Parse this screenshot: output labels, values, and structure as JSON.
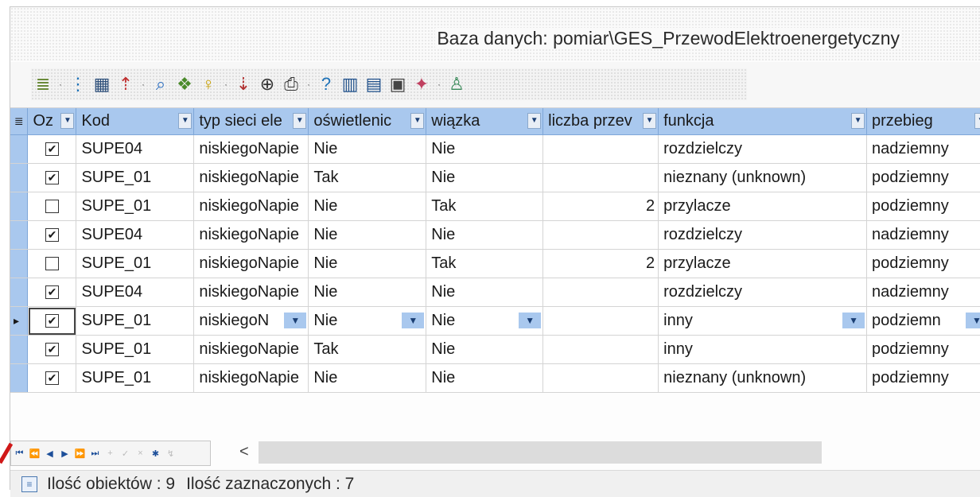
{
  "window": {
    "title": "Baza danych: pomiar\\GES_PrzewodElektroenergetyczny"
  },
  "toolbar": {
    "buttons": [
      {
        "name": "list-view-icon",
        "glyph": "≣",
        "color": "#6a8a3a",
        "dropdown": true
      },
      {
        "name": "tree-view-icon",
        "glyph": "⋮",
        "color": "#1e72b8",
        "dropdown": false
      },
      {
        "name": "table-view-icon",
        "glyph": "▦",
        "color": "#2d4f7a",
        "dropdown": false
      },
      {
        "name": "export-icon",
        "glyph": "⇡",
        "color": "#c03030",
        "dropdown": true
      },
      {
        "name": "search-icon",
        "glyph": "⌕",
        "color": "#2d6fc0",
        "dropdown": false
      },
      {
        "name": "find-icon",
        "glyph": "❖",
        "color": "#4a8a2a",
        "dropdown": false
      },
      {
        "name": "bulb-icon",
        "glyph": "♀",
        "color": "#c8a000",
        "dropdown": true
      },
      {
        "name": "xyh-icon",
        "glyph": "⇣",
        "color": "#b03030",
        "dropdown": false
      },
      {
        "name": "zoom-icon",
        "glyph": "⊕",
        "color": "#333333",
        "dropdown": false
      },
      {
        "name": "print-icon",
        "glyph": "⎙",
        "color": "#333333",
        "dropdown": true
      },
      {
        "name": "help-icon",
        "glyph": "?",
        "color": "#1e72b8",
        "dropdown": false
      },
      {
        "name": "columns-icon",
        "glyph": "▥",
        "color": "#1e4f8a",
        "dropdown": false
      },
      {
        "name": "columns-edit-icon",
        "glyph": "▤",
        "color": "#1e4f8a",
        "dropdown": false
      },
      {
        "name": "copy-grid-icon",
        "glyph": "▣",
        "color": "#444444",
        "dropdown": false
      },
      {
        "name": "gml-icon",
        "glyph": "✦",
        "color": "#c04060",
        "dropdown": true
      },
      {
        "name": "user-icon",
        "glyph": "♙",
        "color": "#3a8a5a",
        "dropdown": false
      }
    ]
  },
  "grid": {
    "columns": [
      {
        "label": "Oz"
      },
      {
        "label": "Kod"
      },
      {
        "label": "typ sieci ele"
      },
      {
        "label": "oświetlenic"
      },
      {
        "label": "wiązka"
      },
      {
        "label": "liczba przev"
      },
      {
        "label": "funkcja"
      },
      {
        "label": "przebieg"
      }
    ],
    "rows": [
      {
        "checked": true,
        "kod": "SUPE04",
        "typ": "niskiegoNapie",
        "osw": "Nie",
        "wiazka": "Nie",
        "liczba": "",
        "funkcja": "rozdzielczy",
        "przebieg": "nadziemny"
      },
      {
        "checked": true,
        "kod": "SUPE_01",
        "typ": "niskiegoNapie",
        "osw": "Tak",
        "wiazka": "Nie",
        "liczba": "",
        "funkcja": "nieznany (unknown)",
        "przebieg": "podziemny"
      },
      {
        "checked": false,
        "kod": "SUPE_01",
        "typ": "niskiegoNapie",
        "osw": "Nie",
        "wiazka": "Tak",
        "liczba": "2",
        "funkcja": "przylacze",
        "przebieg": "podziemny"
      },
      {
        "checked": true,
        "kod": "SUPE04",
        "typ": "niskiegoNapie",
        "osw": "Nie",
        "wiazka": "Nie",
        "liczba": "",
        "funkcja": "rozdzielczy",
        "przebieg": "nadziemny"
      },
      {
        "checked": false,
        "kod": "SUPE_01",
        "typ": "niskiegoNapie",
        "osw": "Nie",
        "wiazka": "Tak",
        "liczba": "2",
        "funkcja": "przylacze",
        "przebieg": "podziemny"
      },
      {
        "checked": true,
        "kod": "SUPE04",
        "typ": "niskiegoNapie",
        "osw": "Nie",
        "wiazka": "Nie",
        "liczba": "",
        "funkcja": "rozdzielczy",
        "przebieg": "nadziemny"
      },
      {
        "checked": true,
        "kod": "SUPE_01",
        "typ": "niskiegoN",
        "osw": "Nie",
        "wiazka": "Nie",
        "liczba": "",
        "funkcja": "inny",
        "przebieg": "podziemn",
        "current": true
      },
      {
        "checked": true,
        "kod": "SUPE_01",
        "typ": "niskiegoNapie",
        "osw": "Tak",
        "wiazka": "Nie",
        "liczba": "",
        "funkcja": "inny",
        "przebieg": "podziemny"
      },
      {
        "checked": true,
        "kod": "SUPE_01",
        "typ": "niskiegoNapie",
        "osw": "Nie",
        "wiazka": "Nie",
        "liczba": "",
        "funkcja": "nieznany (unknown)",
        "przebieg": "podziemny"
      }
    ]
  },
  "navigator": {
    "buttons": [
      {
        "name": "nav-first-button",
        "glyph": "⏮",
        "enabled": true
      },
      {
        "name": "nav-prev-page-button",
        "glyph": "⏪",
        "enabled": true
      },
      {
        "name": "nav-prev-button",
        "glyph": "◀",
        "enabled": true
      },
      {
        "name": "nav-next-button",
        "glyph": "▶",
        "enabled": true
      },
      {
        "name": "nav-next-page-button",
        "glyph": "⏩",
        "enabled": true
      },
      {
        "name": "nav-last-button",
        "glyph": "⏭",
        "enabled": true
      },
      {
        "name": "nav-add-button",
        "glyph": "+",
        "enabled": false
      },
      {
        "name": "nav-confirm-button",
        "glyph": "✓",
        "enabled": false
      },
      {
        "name": "nav-delete-button",
        "glyph": "×",
        "enabled": false
      },
      {
        "name": "nav-star-button",
        "glyph": "✱",
        "enabled": true
      },
      {
        "name": "nav-filter-button",
        "glyph": "↯",
        "enabled": false
      }
    ],
    "scroll_left_glyph": "<"
  },
  "status": {
    "icon": "document-icon",
    "objects": "Ilość obiektów : 9",
    "selected": "Ilość zaznaczonych : 7"
  },
  "colors": {
    "header": "#a9c8ee",
    "accent": "#1d4f9a",
    "annotation": "#d01818"
  }
}
